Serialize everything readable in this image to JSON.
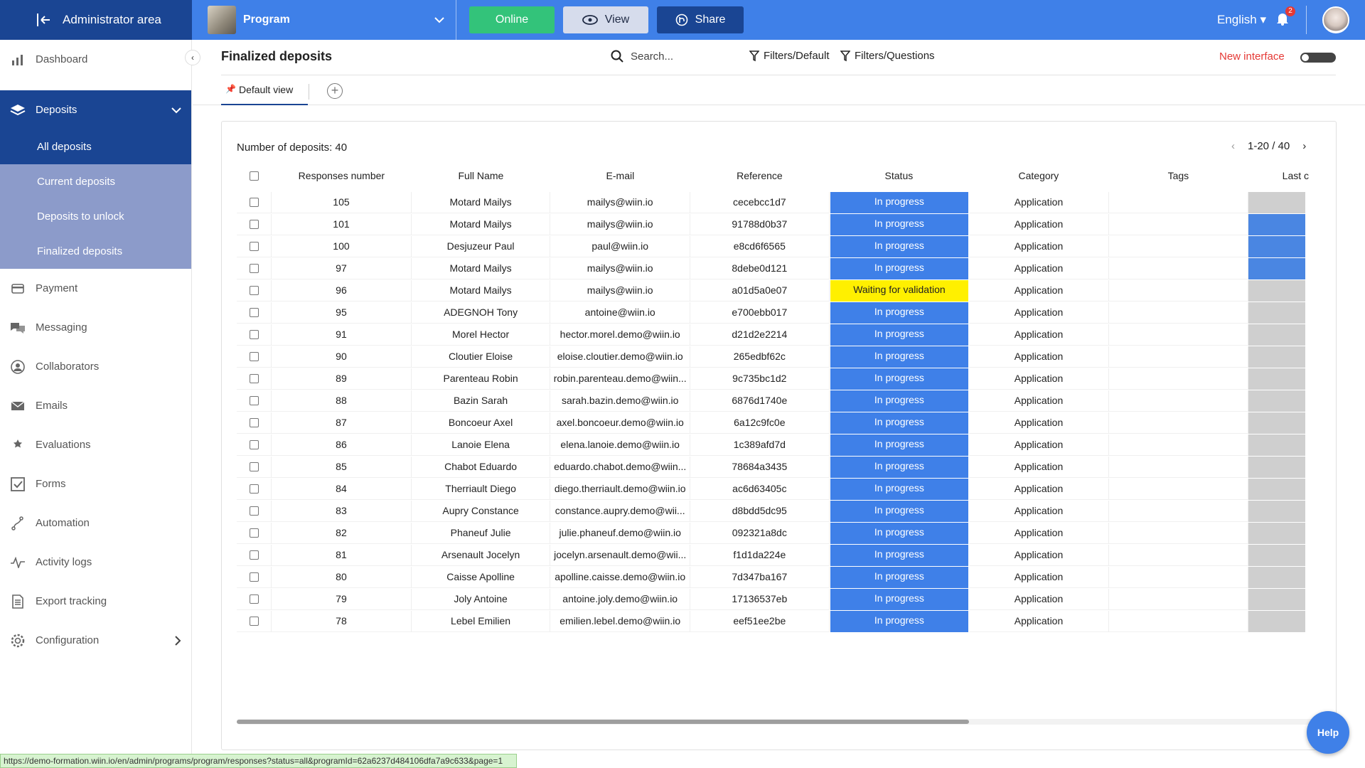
{
  "topbar": {
    "admin_label": "Administrator area",
    "program_label": "Program",
    "online_label": "Online",
    "view_label": "View",
    "share_label": "Share",
    "language": "English",
    "notifications": "2"
  },
  "sidebar": {
    "items": [
      {
        "label": "Dashboard",
        "icon": "bar-chart-icon"
      },
      {
        "label": "Deposits",
        "icon": "layers-icon"
      },
      {
        "label": "Payment",
        "icon": "card-icon"
      },
      {
        "label": "Messaging",
        "icon": "chat-icon"
      },
      {
        "label": "Collaborators",
        "icon": "user-icon"
      },
      {
        "label": "Emails",
        "icon": "mail-icon"
      },
      {
        "label": "Evaluations",
        "icon": "stars-icon"
      },
      {
        "label": "Forms",
        "icon": "checkbox-icon"
      },
      {
        "label": "Automation",
        "icon": "automation-icon"
      },
      {
        "label": "Activity logs",
        "icon": "pulse-icon"
      },
      {
        "label": "Export tracking",
        "icon": "document-icon"
      },
      {
        "label": "Configuration",
        "icon": "gear-icon"
      }
    ],
    "deposits_sub": [
      "All deposits",
      "Current deposits",
      "Deposits to unlock",
      "Finalized deposits"
    ]
  },
  "header": {
    "title": "Finalized deposits",
    "search_placeholder": "Search...",
    "filter_default": "Filters/Default",
    "filter_questions": "Filters/Questions",
    "new_interface": "New interface",
    "tab_default": "Default view"
  },
  "table": {
    "count_label": "Number of deposits: 40",
    "pagination": "1-20 / 40",
    "columns": [
      "Responses number",
      "Full Name",
      "E-mail",
      "Reference",
      "Status",
      "Category",
      "Tags",
      "Last c"
    ],
    "rows": [
      {
        "num": "105",
        "name": "Motard Mailys",
        "email": "mailys@wiin.io",
        "ref": "cecebcc1d7",
        "status": "In progress",
        "category": "Application",
        "tags": "",
        "last": "g"
      },
      {
        "num": "101",
        "name": "Motard Mailys",
        "email": "mailys@wiin.io",
        "ref": "91788d0b37",
        "status": "In progress",
        "category": "Application",
        "tags": "",
        "last": "b"
      },
      {
        "num": "100",
        "name": "Desjuzeur Paul",
        "email": "paul@wiin.io",
        "ref": "e8cd6f6565",
        "status": "In progress",
        "category": "Application",
        "tags": "",
        "last": "b"
      },
      {
        "num": "97",
        "name": "Motard Mailys",
        "email": "mailys@wiin.io",
        "ref": "8debe0d121",
        "status": "In progress",
        "category": "Application",
        "tags": "",
        "last": "b"
      },
      {
        "num": "96",
        "name": "Motard Mailys",
        "email": "mailys@wiin.io",
        "ref": "a01d5a0e07",
        "status": "Waiting for validation",
        "category": "Application",
        "tags": "",
        "last": "g"
      },
      {
        "num": "95",
        "name": "ADEGNOH Tony",
        "email": "antoine@wiin.io",
        "ref": "e700ebb017",
        "status": "In progress",
        "category": "Application",
        "tags": "",
        "last": "g"
      },
      {
        "num": "91",
        "name": "Morel Hector",
        "email": "hector.morel.demo@wiin.io",
        "ref": "d21d2e2214",
        "status": "In progress",
        "category": "Application",
        "tags": "",
        "last": "g"
      },
      {
        "num": "90",
        "name": "Cloutier Eloise",
        "email": "eloise.cloutier.demo@wiin.io",
        "ref": "265edbf62c",
        "status": "In progress",
        "category": "Application",
        "tags": "",
        "last": "g"
      },
      {
        "num": "89",
        "name": "Parenteau Robin",
        "email": "robin.parenteau.demo@wiin...",
        "ref": "9c735bc1d2",
        "status": "In progress",
        "category": "Application",
        "tags": "",
        "last": "g"
      },
      {
        "num": "88",
        "name": "Bazin Sarah",
        "email": "sarah.bazin.demo@wiin.io",
        "ref": "6876d1740e",
        "status": "In progress",
        "category": "Application",
        "tags": "",
        "last": "g"
      },
      {
        "num": "87",
        "name": "Boncoeur Axel",
        "email": "axel.boncoeur.demo@wiin.io",
        "ref": "6a12c9fc0e",
        "status": "In progress",
        "category": "Application",
        "tags": "",
        "last": "g"
      },
      {
        "num": "86",
        "name": "Lanoie Elena",
        "email": "elena.lanoie.demo@wiin.io",
        "ref": "1c389afd7d",
        "status": "In progress",
        "category": "Application",
        "tags": "",
        "last": "g"
      },
      {
        "num": "85",
        "name": "Chabot Eduardo",
        "email": "eduardo.chabot.demo@wiin...",
        "ref": "78684a3435",
        "status": "In progress",
        "category": "Application",
        "tags": "",
        "last": "g"
      },
      {
        "num": "84",
        "name": "Therriault Diego",
        "email": "diego.therriault.demo@wiin.io",
        "ref": "ac6d63405c",
        "status": "In progress",
        "category": "Application",
        "tags": "",
        "last": "g"
      },
      {
        "num": "83",
        "name": "Aupry Constance",
        "email": "constance.aupry.demo@wii...",
        "ref": "d8bdd5dc95",
        "status": "In progress",
        "category": "Application",
        "tags": "",
        "last": "g"
      },
      {
        "num": "82",
        "name": "Phaneuf Julie",
        "email": "julie.phaneuf.demo@wiin.io",
        "ref": "092321a8dc",
        "status": "In progress",
        "category": "Application",
        "tags": "",
        "last": "g"
      },
      {
        "num": "81",
        "name": "Arsenault Jocelyn",
        "email": "jocelyn.arsenault.demo@wii...",
        "ref": "f1d1da224e",
        "status": "In progress",
        "category": "Application",
        "tags": "",
        "last": "g"
      },
      {
        "num": "80",
        "name": "Caisse Apolline",
        "email": "apolline.caisse.demo@wiin.io",
        "ref": "7d347ba167",
        "status": "In progress",
        "category": "Application",
        "tags": "",
        "last": "g"
      },
      {
        "num": "79",
        "name": "Joly Antoine",
        "email": "antoine.joly.demo@wiin.io",
        "ref": "17136537eb",
        "status": "In progress",
        "category": "Application",
        "tags": "",
        "last": "g"
      },
      {
        "num": "78",
        "name": "Lebel Emilien",
        "email": "emilien.lebel.demo@wiin.io",
        "ref": "eef51ee2be",
        "status": "In progress",
        "category": "Application",
        "tags": "",
        "last": "g"
      }
    ]
  },
  "help_label": "Help",
  "status_url": "https://demo-formation.wiin.io/en/admin/programs/program/responses?status=all&programId=62a6237d484106dfa7a9c633&page=1",
  "colors": {
    "primary": "#3f80e8",
    "dark": "#1a4593",
    "online": "#33c37a",
    "waiting": "#fff000",
    "new_interface": "#e53935"
  }
}
